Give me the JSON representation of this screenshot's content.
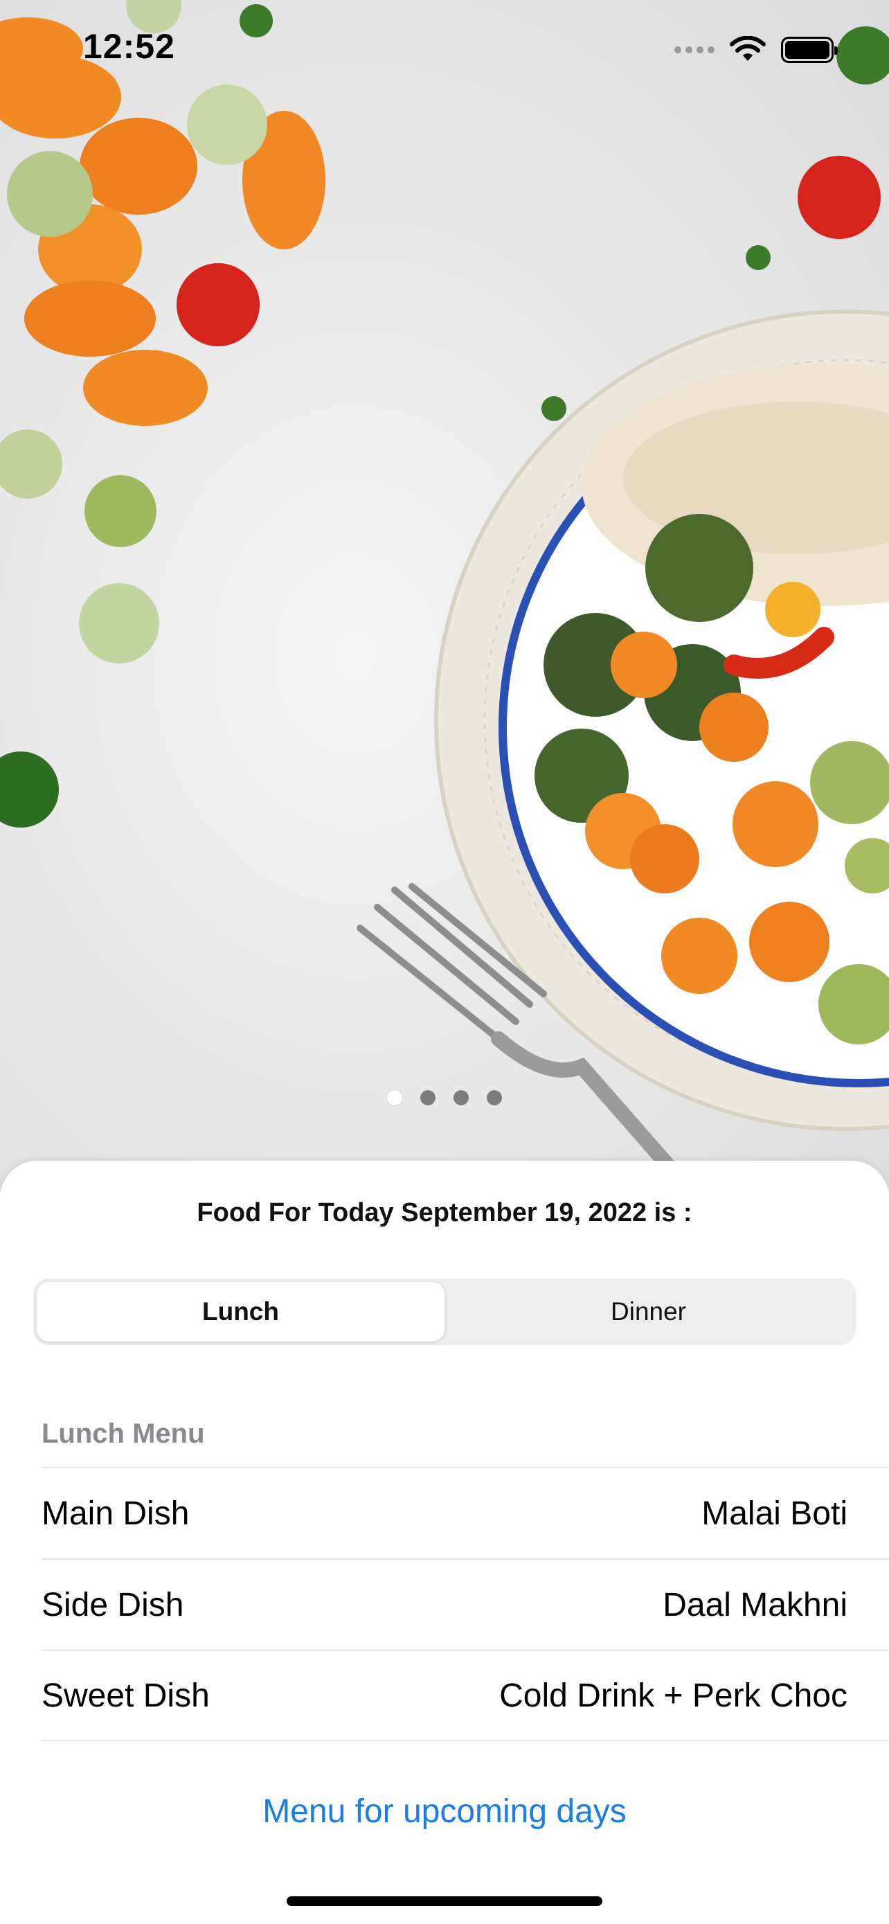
{
  "status_bar": {
    "time": "12:52"
  },
  "hero": {
    "page_count": 4,
    "active_page": 1
  },
  "sheet": {
    "title": "Food For Today September 19, 2022 is :",
    "segments": [
      "Lunch",
      "Dinner"
    ],
    "selected_segment": "Lunch",
    "section_header": "Lunch Menu",
    "rows": [
      {
        "label": "Main Dish",
        "value": "Malai Boti"
      },
      {
        "label": "Side Dish",
        "value": "Daal Makhni"
      },
      {
        "label": "Sweet Dish",
        "value": "Cold Drink + Perk Choc"
      }
    ],
    "link": "Menu for upcoming days"
  },
  "colors": {
    "link": "#1a7ee6",
    "section_header": "#8a8a8e"
  }
}
